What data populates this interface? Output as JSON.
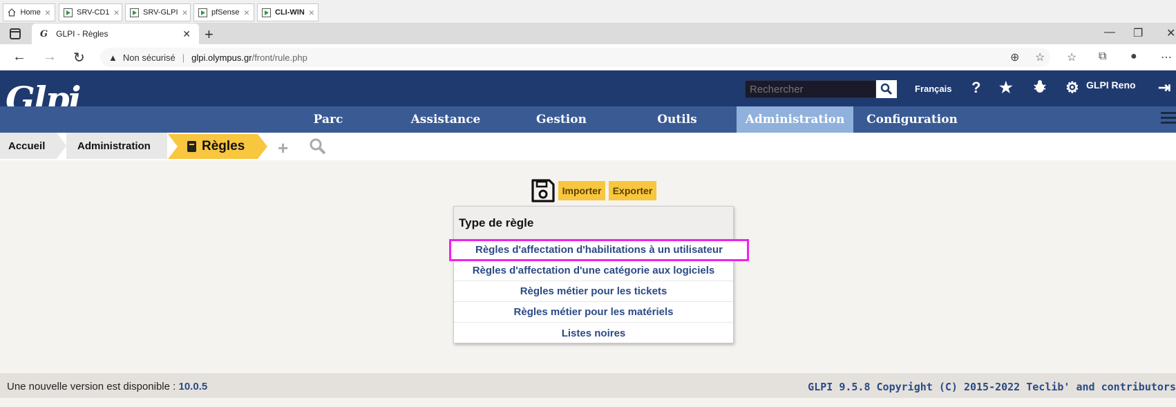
{
  "vm_tabs": [
    {
      "label": "Home",
      "icon": "home-icon"
    },
    {
      "label": "SRV-CD1",
      "icon": "vm-icon"
    },
    {
      "label": "SRV-GLPI",
      "icon": "vm-icon"
    },
    {
      "label": "pfSense",
      "icon": "vm-icon"
    },
    {
      "label": "CLI-WIN",
      "icon": "vm-icon"
    }
  ],
  "browser": {
    "tab_title": "GLPI - Règles",
    "address": {
      "security": "Non sécurisé",
      "host": "glpi.olympus.gr",
      "path": "/front/rule.php"
    }
  },
  "header": {
    "search_placeholder": "Rechercher",
    "language": "Français",
    "user": "GLPI Reno"
  },
  "menu": [
    "Parc",
    "Assistance",
    "Gestion",
    "Outils",
    "Administration",
    "Configuration"
  ],
  "active_menu": "Administration",
  "breadcrumb": {
    "home": "Accueil",
    "section": "Administration",
    "current": "Règles"
  },
  "actions": {
    "import": "Importer",
    "export": "Exporter"
  },
  "rules": {
    "header": "Type de règle",
    "items": [
      "Règles d'affectation d'habilitations à un utilisateur",
      "Règles d'affectation d'une catégorie aux logiciels",
      "Règles métier pour les tickets",
      "Règles métier pour les matériels",
      "Listes noires"
    ]
  },
  "footer": {
    "update_text": "Une nouvelle version est disponible :",
    "update_version": "10.0.5",
    "copyright": "GLPI 9.5.8 Copyright (C) 2015-2022 Teclib' and contributors"
  },
  "colors": {
    "header_bg": "#1f3a6e",
    "menu_bg": "#3a5a94",
    "active_menu": "#8fb1dc",
    "accent": "#f8c63f",
    "link": "#2b4a86",
    "highlight": "#ee22ee"
  }
}
